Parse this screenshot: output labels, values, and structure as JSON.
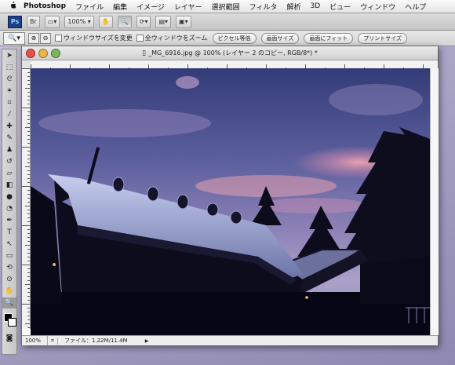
{
  "menubar": {
    "apple": "",
    "app": "Photoshop",
    "items": [
      "ファイル",
      "編集",
      "イメージ",
      "レイヤー",
      "選択範囲",
      "フィルタ",
      "解析",
      "3D",
      "ビュー",
      "ウィンドウ",
      "ヘルプ"
    ]
  },
  "appbar": {
    "ps_logo": "Ps",
    "bridge": "Br",
    "zoom": "100%"
  },
  "options": {
    "checkbox_resize": "ウィンドウサイズを変更",
    "checkbox_all": "全ウィンドウをズーム",
    "buttons": [
      "ピクセル等倍",
      "画面サイズ",
      "画面にフィット",
      "プリントサイズ"
    ]
  },
  "document": {
    "title": "_MG_6916.jpg @ 100% (レイヤー 2 のコピー, RGB/8*) *",
    "status_zoom": "100%",
    "file_info": "ファイル：1.22M/11.4M"
  },
  "colors": {
    "sky_top": "#3d4680",
    "sky_mid": "#7b77b0",
    "sunset_pink": "#e89aa8",
    "silhouette": "#0d0c1c",
    "snow": "#bcc3e6"
  }
}
